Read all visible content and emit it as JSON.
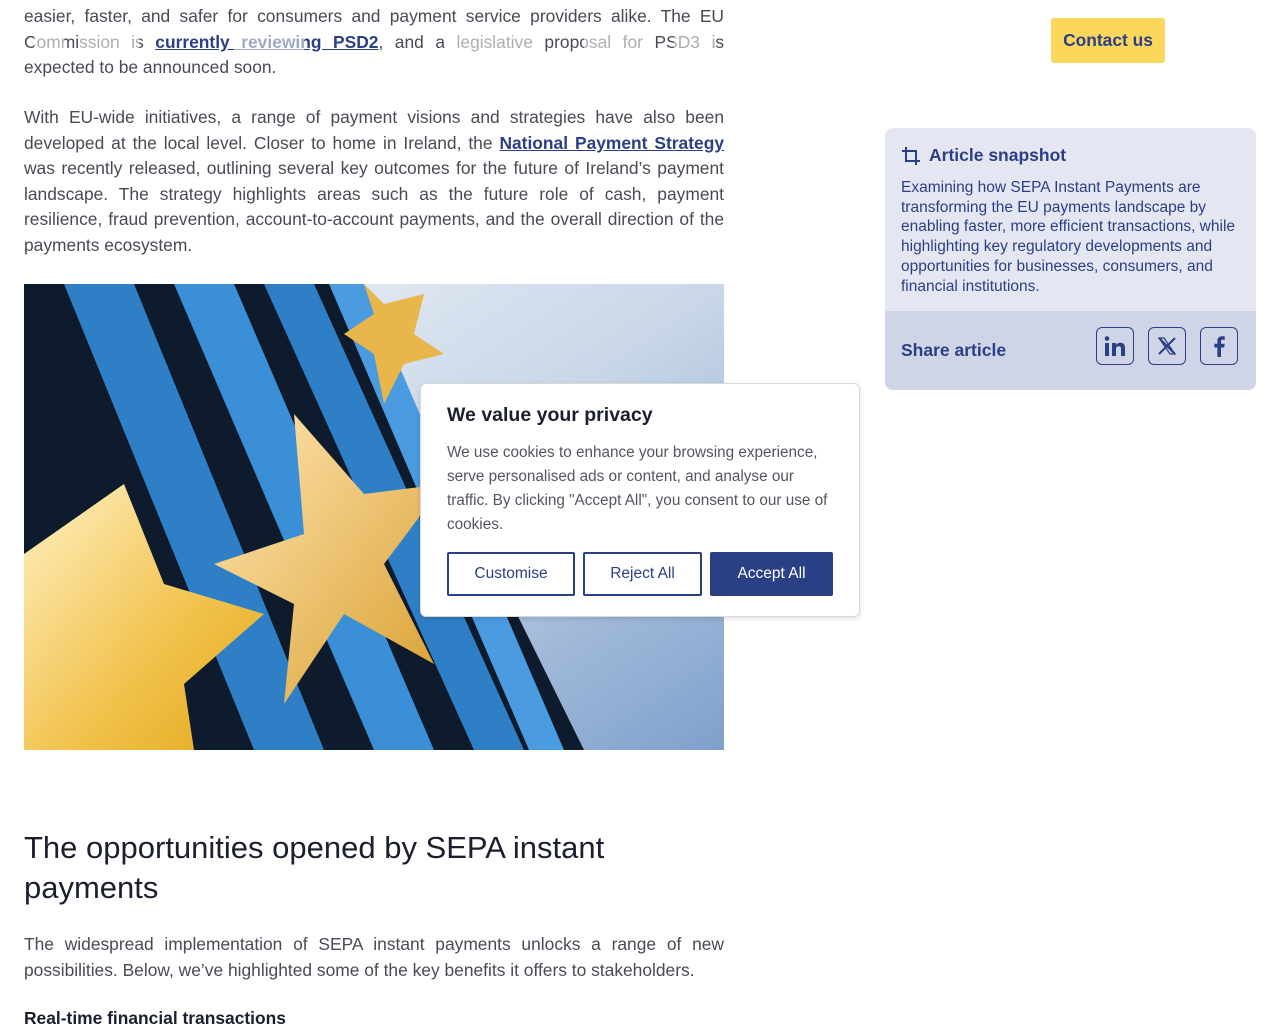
{
  "article": {
    "p1": {
      "line1": "easier, faster, and safer for consumers and payment service providers alike. The EU",
      "pre_link": "Commission is ",
      "link": "currently reviewing PSD2",
      "post_link": ", and a legislative proposal for PSD3 is expected to be announced soon."
    },
    "p2": {
      "pre_link": "With EU-wide initiatives, a range of payment visions and strategies have also been developed at the local level. Closer to home in Ireland, the ",
      "link": "National Payment Strategy",
      "post_link": " was recently released, outlining several key outcomes for the future of Ireland’s payment landscape. The strategy highlights areas such as the future role of cash, payment resilience, fraud prevention, account-to-account payments, and the overall direction of the payments ecosystem."
    },
    "section_title": "The opportunities opened by SEPA instant payments",
    "p3": "The widespread implementation of SEPA instant payments unlocks a range of new possibilities. Below, we’ve highlighted some of the key benefits it offers to stakeholders.",
    "subheading": "Real-time financial transactions"
  },
  "header": {
    "contact_label": "Contact us"
  },
  "snapshot": {
    "title": "Article snapshot",
    "icon": "crop-icon",
    "body": "Examining how SEPA Instant Payments are transforming the EU payments landscape by enabling faster, more efficient transactions, while highlighting key regulatory developments and opportunities for businesses, consumers, and financial institutions.",
    "share_label": "Share article",
    "share_icons": [
      "linkedin-icon",
      "x-icon",
      "facebook-icon"
    ]
  },
  "cookie": {
    "title": "We value your privacy",
    "body": "We use cookies to enhance your browsing experience, serve personalised ads or content, and analyse our traffic. By clicking \"Accept All\", you consent to our use of cookies.",
    "customise": "Customise",
    "reject": "Reject All",
    "accept": "Accept All"
  },
  "colors": {
    "brand_navy": "#2b3f86",
    "accent_yellow": "#fbd75b",
    "snapshot_bg": "#e4e7f1",
    "share_bg": "#cfd4e6"
  }
}
